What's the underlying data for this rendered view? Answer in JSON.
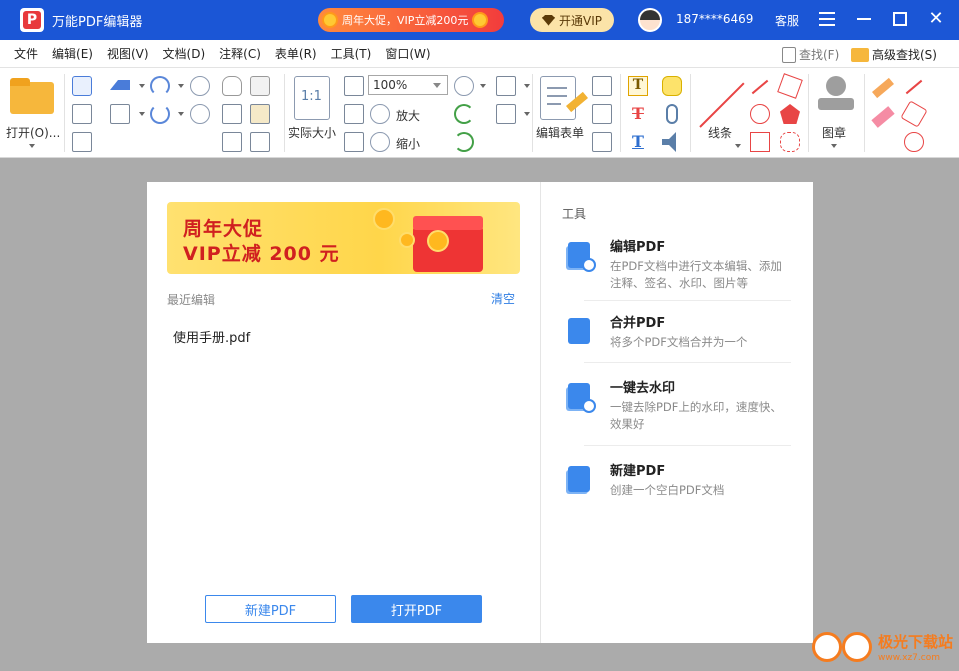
{
  "titlebar": {
    "app_title": "万能PDF编辑器",
    "logo_letter": "P",
    "promo": "周年大促，VIP立减200元",
    "vip_button": "开通VIP",
    "phone": "187****6469",
    "service": "客服"
  },
  "menubar": {
    "items": [
      "文件",
      "编辑(E)",
      "视图(V)",
      "文档(D)",
      "注释(C)",
      "表单(R)",
      "工具(T)",
      "窗口(W)"
    ],
    "search": "查找(F)",
    "advanced_search": "高级查找(S)"
  },
  "toolbar": {
    "open_label": "打开(O)...",
    "actual_size_label": "实际大小",
    "actual_size_icon_text": "1:1",
    "zoom_value": "100%",
    "zoom_in_label": "放大",
    "zoom_out_label": "缩小",
    "edit_form_label": "编辑表单",
    "lines_label": "线条",
    "stamp_label": "图章"
  },
  "home": {
    "banner_line1": "周年大促",
    "banner_line2": "VIP立减 200 元",
    "recent_label": "最近编辑",
    "clear_label": "清空",
    "recent_files": [
      "使用手册.pdf"
    ],
    "new_pdf_button": "新建PDF",
    "open_pdf_button": "打开PDF"
  },
  "tools": {
    "title": "工具",
    "items": [
      {
        "name": "编辑PDF",
        "desc": "在PDF文档中进行文本编辑、添加注释、签名、水印、图片等"
      },
      {
        "name": "合并PDF",
        "desc": "将多个PDF文档合并为一个"
      },
      {
        "name": "一键去水印",
        "desc": "一键去除PDF上的水印，速度快、效果好"
      },
      {
        "name": "新建PDF",
        "desc": "创建一个空白PDF文档"
      }
    ]
  },
  "watermark": {
    "text": "极光下载站",
    "url": "www.xz7.com"
  },
  "colors": {
    "titlebar": "#1b56d6",
    "accent": "#3b88ec",
    "banner_red": "#d02020",
    "workspace": "#ababab"
  }
}
